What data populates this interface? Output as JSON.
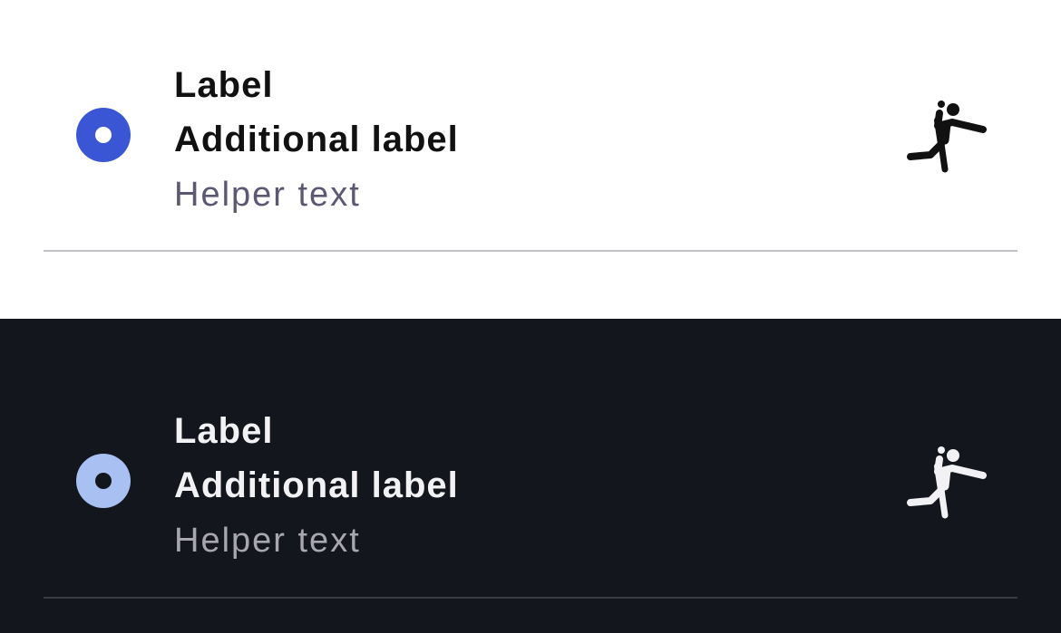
{
  "light": {
    "label": "Label",
    "additional_label": "Additional label",
    "helper_text": "Helper text",
    "radio_selected": true,
    "icon": "sports-handball-icon",
    "colors": {
      "background": "#ffffff",
      "radio_ring": "#3a56d4",
      "radio_dot": "#ffffff",
      "label": "#111111",
      "helper": "#5b5873",
      "icon": "#111111",
      "divider": "#c2c2c6"
    }
  },
  "dark": {
    "label": "Label",
    "additional_label": "Additional label",
    "helper_text": "Helper text",
    "radio_selected": true,
    "icon": "sports-handball-icon",
    "colors": {
      "background": "#14161d",
      "radio_ring": "#a9c0f2",
      "radio_dot": "#14161d",
      "label": "#f2f2f4",
      "helper": "#a7a7ad",
      "icon": "#f2f2f4",
      "divider": "#3a3c44"
    }
  }
}
